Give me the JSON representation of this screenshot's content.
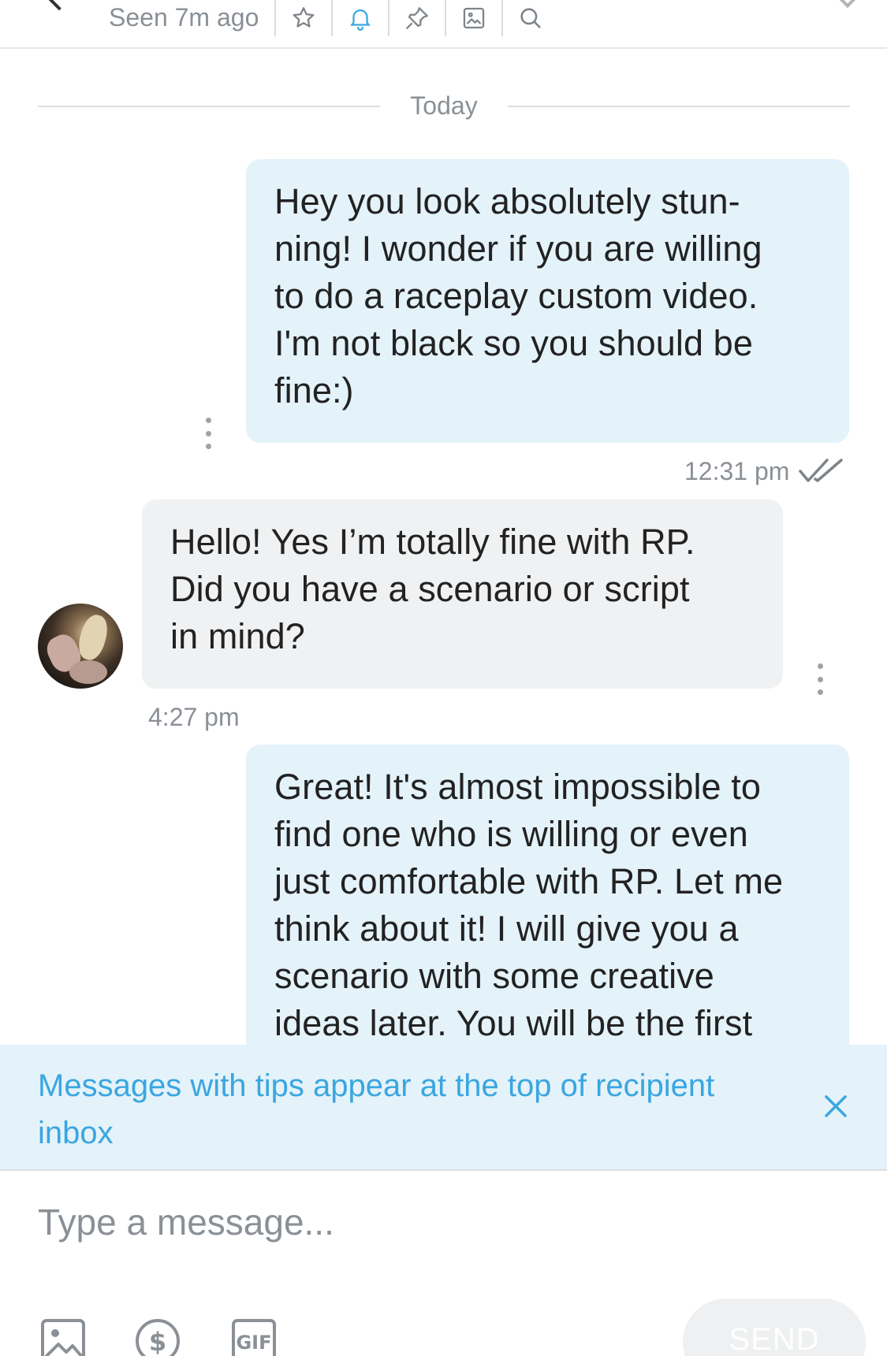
{
  "header": {
    "seen_status": "Seen 7m ago",
    "icons": [
      "star-icon",
      "bell-icon",
      "pin-icon",
      "image-icon",
      "search-icon"
    ],
    "accent_color": "#3aa6e0"
  },
  "divider": {
    "date": "Today"
  },
  "messages": [
    {
      "direction": "outgoing",
      "lines": [
        "Hey you look absolutely stun-",
        "ning! I wonder if you are willing",
        "to do a raceplay custom video.",
        "I'm not black so you should be",
        "fine:)"
      ],
      "time": "12:31 pm",
      "status": "read"
    },
    {
      "direction": "incoming",
      "lines": [
        "Hello! Yes I’m totally fine with RP.",
        "Did you have a scenario or script",
        "in mind?"
      ],
      "time": "4:27 pm"
    },
    {
      "direction": "outgoing",
      "lines": [
        "Great! It's almost impossible to",
        "find one who is willing or even",
        "just comfortable with RP. Let me",
        "think about it! I will give you a",
        "scenario with some creative",
        "ideas later. You will be the first"
      ]
    }
  ],
  "banner": {
    "lines": [
      "Messages with tips appear at the top of recipient",
      "inbox"
    ]
  },
  "composer": {
    "placeholder": "Type a message...",
    "value": "",
    "send_label": "SEND",
    "tools": [
      "image-icon",
      "dollar-icon",
      "gif-icon"
    ]
  },
  "colors": {
    "outgoing_bubble": "#e4f2fa",
    "incoming_bubble": "#f0f1f2",
    "banner_bg": "#e4f2fa",
    "banner_text": "#3aa6e0"
  }
}
